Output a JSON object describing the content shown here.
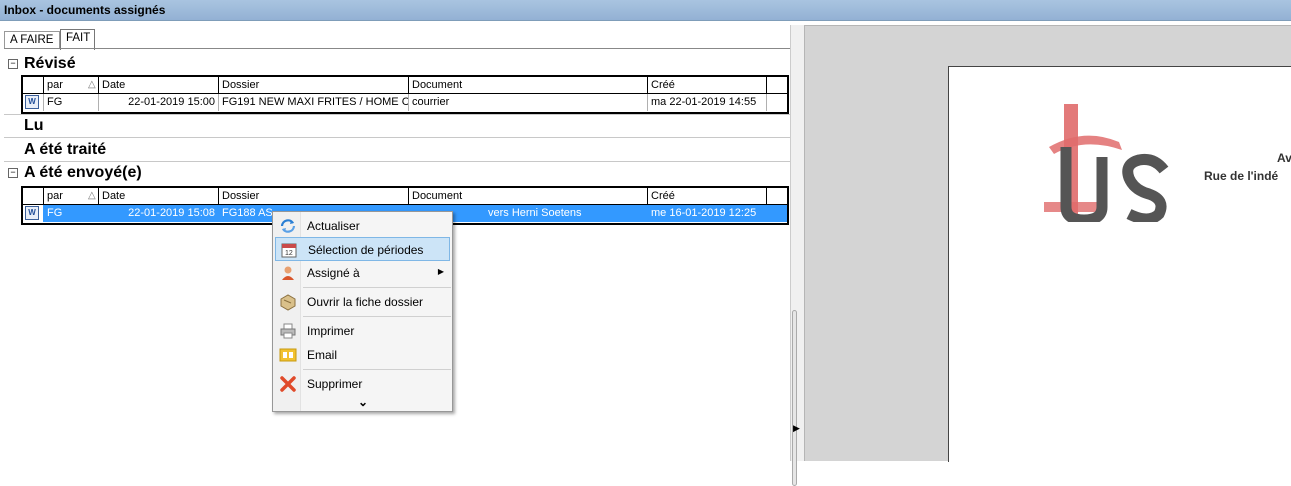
{
  "window": {
    "title": "Inbox - documents assignés"
  },
  "tabs": [
    {
      "label": "A FAIRE",
      "active": false
    },
    {
      "label": "FAIT",
      "active": true
    }
  ],
  "columns": {
    "par": "par",
    "date": "Date",
    "dossier": "Dossier",
    "document": "Document",
    "cree": "Créé"
  },
  "groups": {
    "revise": {
      "title": "Révisé",
      "row": {
        "par": "FG",
        "date": "22-01-2019 15:00",
        "dossier": "FG191 NEW MAXI FRITES / HOME C",
        "document": "courrier",
        "cree": "ma 22-01-2019 14:55"
      }
    },
    "lu": {
      "title": "Lu"
    },
    "traite": {
      "title": "A été traité"
    },
    "envoye": {
      "title": "A été envoyé(e)",
      "row": {
        "par": "FG",
        "date": "22-01-2019 15:08",
        "dossier": "FG188 AS",
        "document": "vers Herni Soetens",
        "cree": "me 16-01-2019 12:25"
      }
    }
  },
  "context_menu": {
    "items": [
      {
        "label": "Actualiser",
        "icon": "refresh-icon"
      },
      {
        "label": "Sélection de périodes",
        "icon": "calendar-icon",
        "hover": true
      },
      {
        "label": "Assigné à",
        "icon": "user-icon",
        "submenu": true
      },
      {
        "label": "Ouvrir la fiche dossier",
        "icon": "folder-card-icon"
      },
      {
        "label": "Imprimer",
        "icon": "printer-icon"
      },
      {
        "label": "Email",
        "icon": "email-icon"
      },
      {
        "label": "Supprimer",
        "icon": "delete-icon"
      }
    ],
    "more_glyph": "⌄"
  },
  "preview": {
    "addr_line1": "Av",
    "addr_line2": "Rue de l'indé"
  },
  "colors": {
    "selection": "#3399ff",
    "title_bar": "#a9c4e0",
    "menu_hover": "#cce4f7",
    "logo_red": "#e06c6c",
    "logo_gray": "#555555"
  }
}
